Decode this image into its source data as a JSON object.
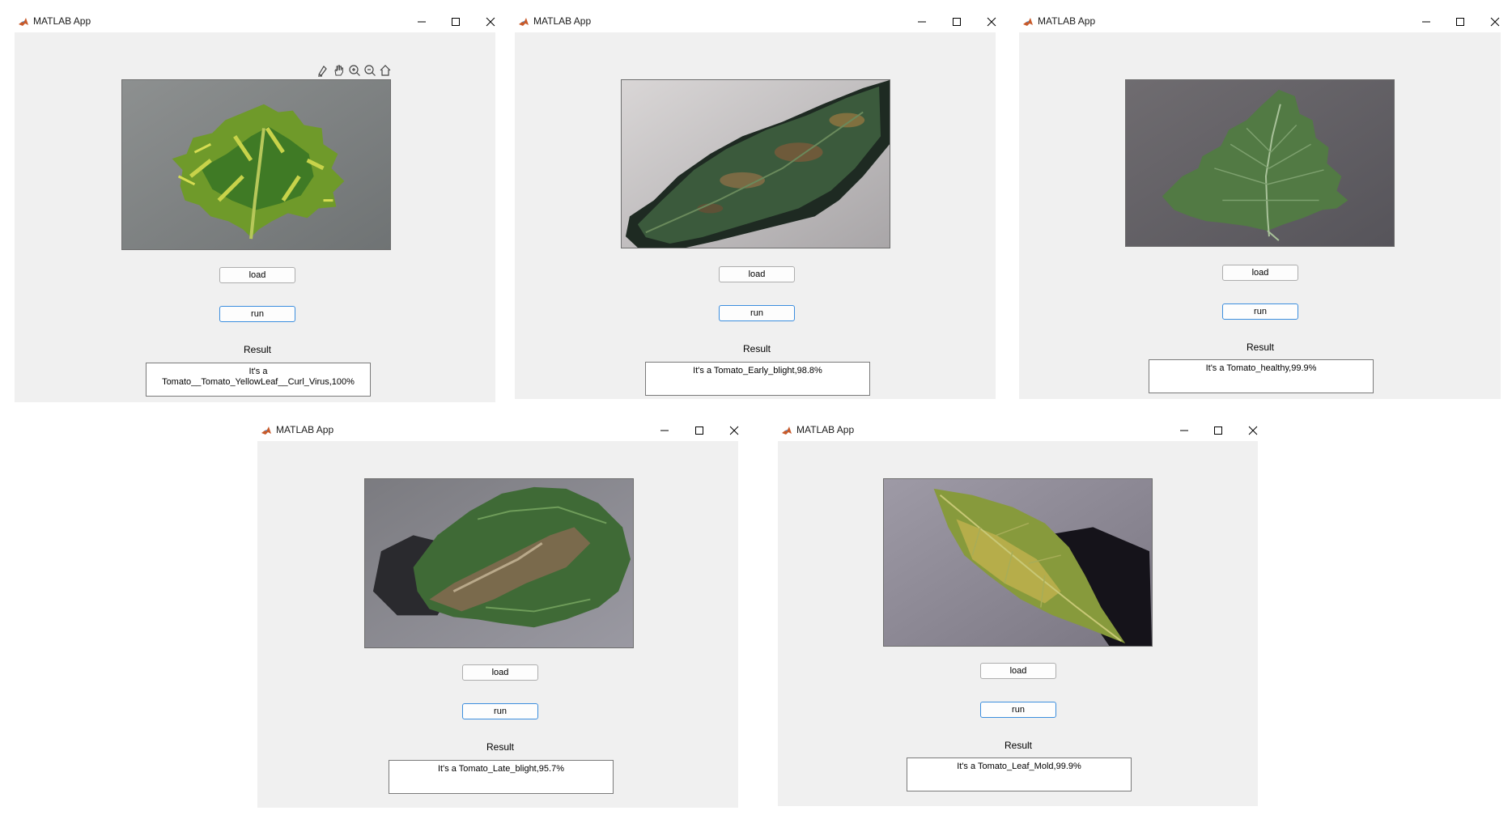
{
  "windows": [
    {
      "title": "MATLAB App",
      "load_label": "load",
      "run_label": "run",
      "result_label": "Result",
      "result_text": "It's a Tomato__Tomato_YellowLeaf__Curl_Virus,100%",
      "image": "yellow-leaf-curl-virus-leaf",
      "axes_toolbar": [
        "brush-icon",
        "pan-hand-icon",
        "zoom-in-icon",
        "zoom-out-icon",
        "home-icon"
      ]
    },
    {
      "title": "MATLAB App",
      "load_label": "load",
      "run_label": "run",
      "result_label": "Result",
      "result_text": "It's a Tomato_Early_blight,98.8%",
      "image": "early-blight-leaf"
    },
    {
      "title": "MATLAB App",
      "load_label": "load",
      "run_label": "run",
      "result_label": "Result",
      "result_text": "It's a Tomato_healthy,99.9%",
      "image": "healthy-leaf"
    },
    {
      "title": "MATLAB App",
      "load_label": "load",
      "run_label": "run",
      "result_label": "Result",
      "result_text": "It's a Tomato_Late_blight,95.7%",
      "image": "late-blight-leaf"
    },
    {
      "title": "MATLAB App",
      "load_label": "load",
      "run_label": "run",
      "result_label": "Result",
      "result_text": "It's a Tomato_Leaf_Mold,99.9%",
      "image": "leaf-mold-leaf"
    }
  ],
  "colors": {
    "client_bg": "#f0f0f0",
    "focus_border": "#3c8ede",
    "button_border": "#adadad"
  }
}
